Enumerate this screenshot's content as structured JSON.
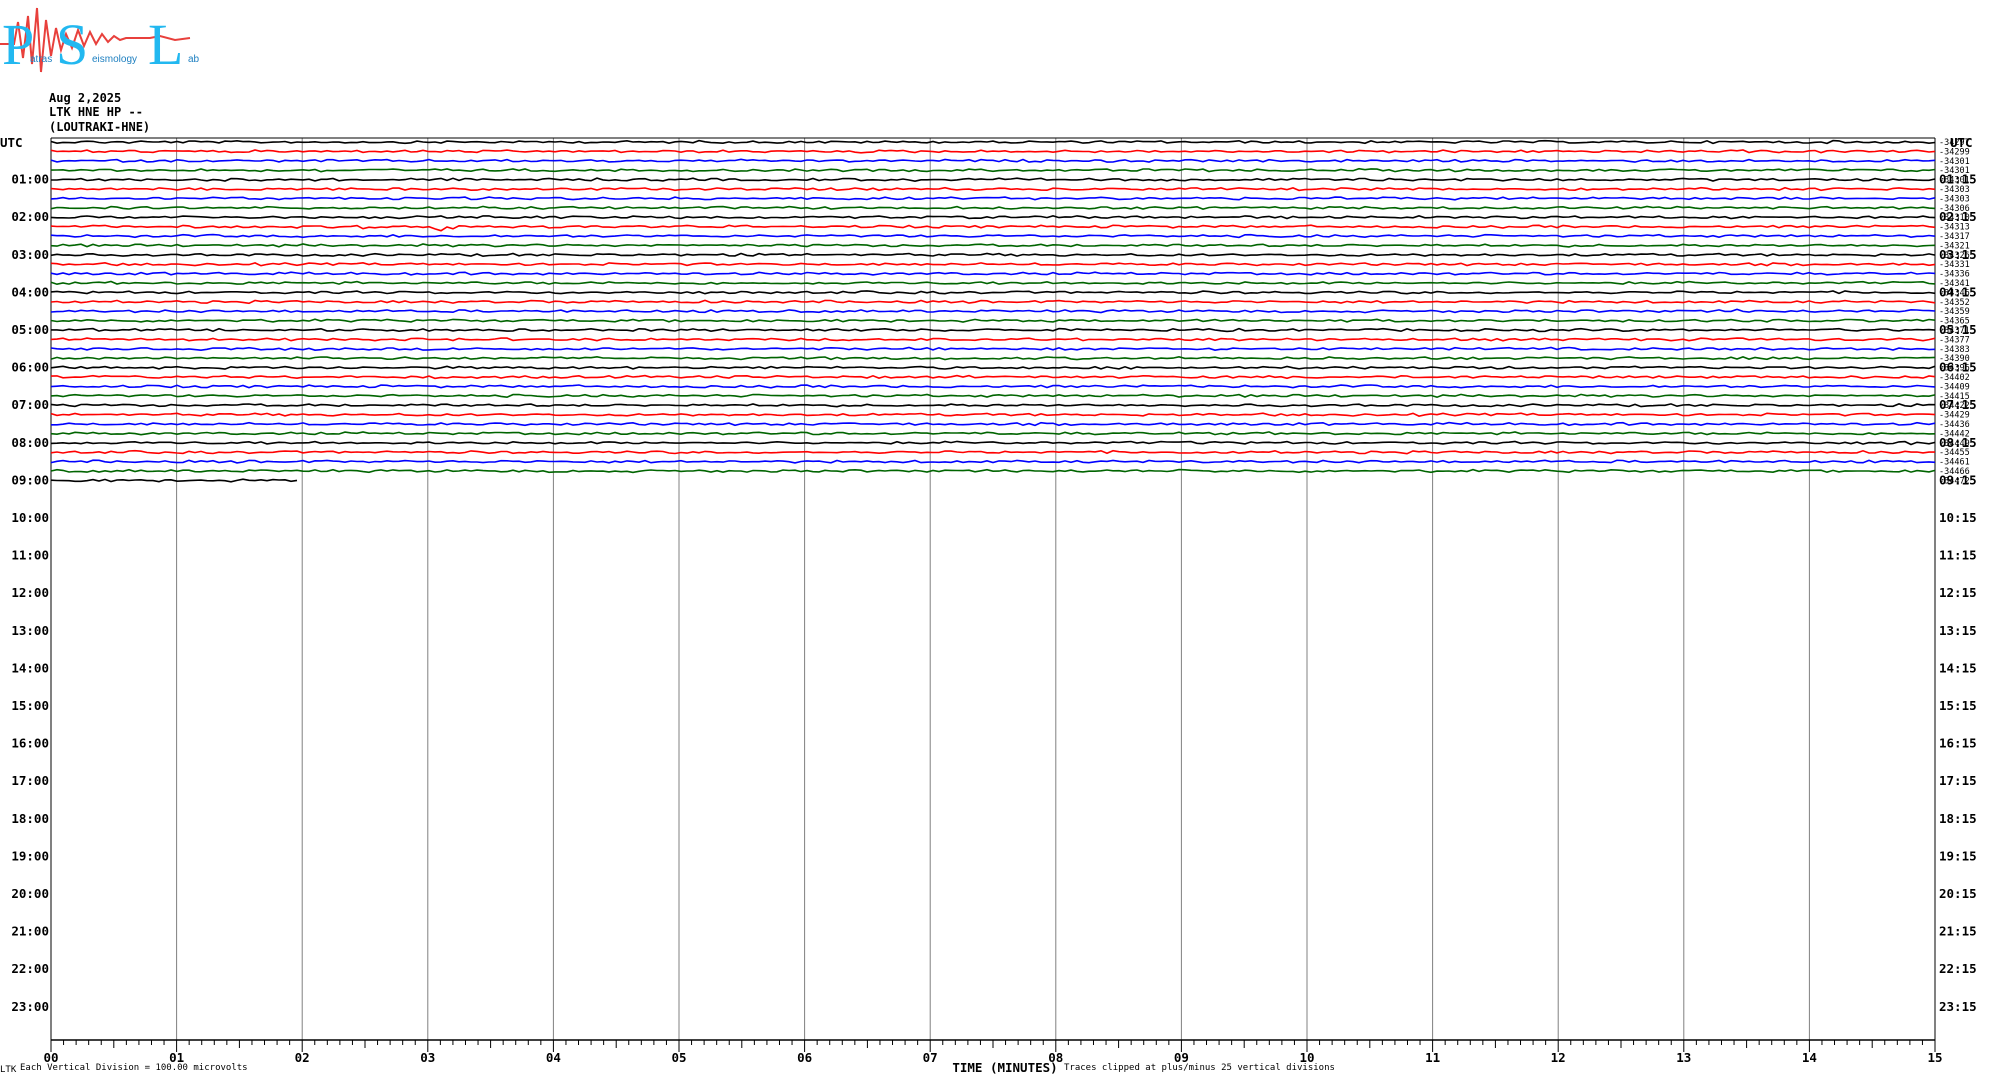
{
  "logo": {
    "big": [
      "P",
      "S",
      "L"
    ],
    "small": [
      "atras",
      "eismology",
      "ab"
    ]
  },
  "header": {
    "date": "Aug 2,2025",
    "station": "LTK HNE HP --",
    "location": "(LOUTRAKI-HNE)"
  },
  "colors": {
    "black": "#000000",
    "red": "#ff0000",
    "blue": "#0000ff",
    "green": "#006400",
    "grid": "#808080",
    "logo_cyan": "#22b8f0",
    "logo_red": "#e8403c"
  },
  "chart_data": {
    "type": "line",
    "trace_colors": [
      "#000000",
      "#ff0000",
      "#0000ff",
      "#006400"
    ],
    "left_axis_label": "UTC",
    "right_axis_label": "UTC",
    "left_hours": [
      "01:00",
      "02:00",
      "03:00",
      "04:00",
      "05:00",
      "06:00",
      "07:00",
      "08:00",
      "09:00",
      "10:00",
      "11:00",
      "12:00",
      "13:00",
      "14:00",
      "15:00",
      "16:00",
      "17:00",
      "18:00",
      "19:00",
      "20:00",
      "21:00",
      "22:00",
      "23:00"
    ],
    "right_hours": [
      "01:15",
      "02:15",
      "03:15",
      "04:15",
      "05:15",
      "06:15",
      "07:15",
      "08:15",
      "09:15",
      "10:15",
      "11:15",
      "12:15",
      "13:15",
      "14:15",
      "15:15",
      "16:15",
      "17:15",
      "18:15",
      "19:15",
      "20:15",
      "21:15",
      "22:15",
      "23:15"
    ],
    "trace_counts": [
      "-34297",
      "-34299",
      "-34301",
      "-34301",
      "-34301",
      "-34303",
      "-34303",
      "-34306",
      "-34310",
      "-34313",
      "-34317",
      "-34321",
      "-34326",
      "-34331",
      "-34336",
      "-34341",
      "-34346",
      "-34352",
      "-34359",
      "-34365",
      "-34371",
      "-34377",
      "-34383",
      "-34390",
      "-34396",
      "-34402",
      "-34409",
      "-34415",
      "-34422",
      "-34429",
      "-34436",
      "-34442",
      "-34449",
      "-34455",
      "-34461",
      "-34466",
      "-34472"
    ],
    "num_full_lines": 36,
    "last_line_minutes": 2.0,
    "x_ticks": [
      "00",
      "01",
      "02",
      "03",
      "04",
      "05",
      "06",
      "07",
      "08",
      "09",
      "10",
      "11",
      "12",
      "13",
      "14",
      "15"
    ],
    "xlim": [
      0,
      15
    ],
    "xlabel": "TIME (MINUTES)",
    "events": [
      {
        "line": 9,
        "minute": 2.5,
        "amplitude": 5
      },
      {
        "line": 9,
        "minute": 2.6,
        "amplitude": 4
      },
      {
        "line": 9,
        "minute": 3.08,
        "amplitude": 7
      },
      {
        "line": 9,
        "minute": 3.17,
        "amplitude": 8
      },
      {
        "line": 4,
        "minute": 6.9,
        "amplitude": 2
      },
      {
        "line": 4,
        "minute": 9.5,
        "amplitude": 2
      },
      {
        "line": 3,
        "minute": 2.2,
        "amplitude": 2
      },
      {
        "line": 10,
        "minute": 10.0,
        "amplitude": 2
      },
      {
        "line": 18,
        "minute": 13.4,
        "amplitude": 2
      },
      {
        "line": 32,
        "minute": 14.8,
        "amplitude": 2
      }
    ]
  },
  "footer": {
    "vertical_division": "Each Vertical Division =  100.00 microvolts",
    "clip_note": "Traces clipped at plus/minus 25 vertical divisions",
    "corner": "LTK"
  }
}
